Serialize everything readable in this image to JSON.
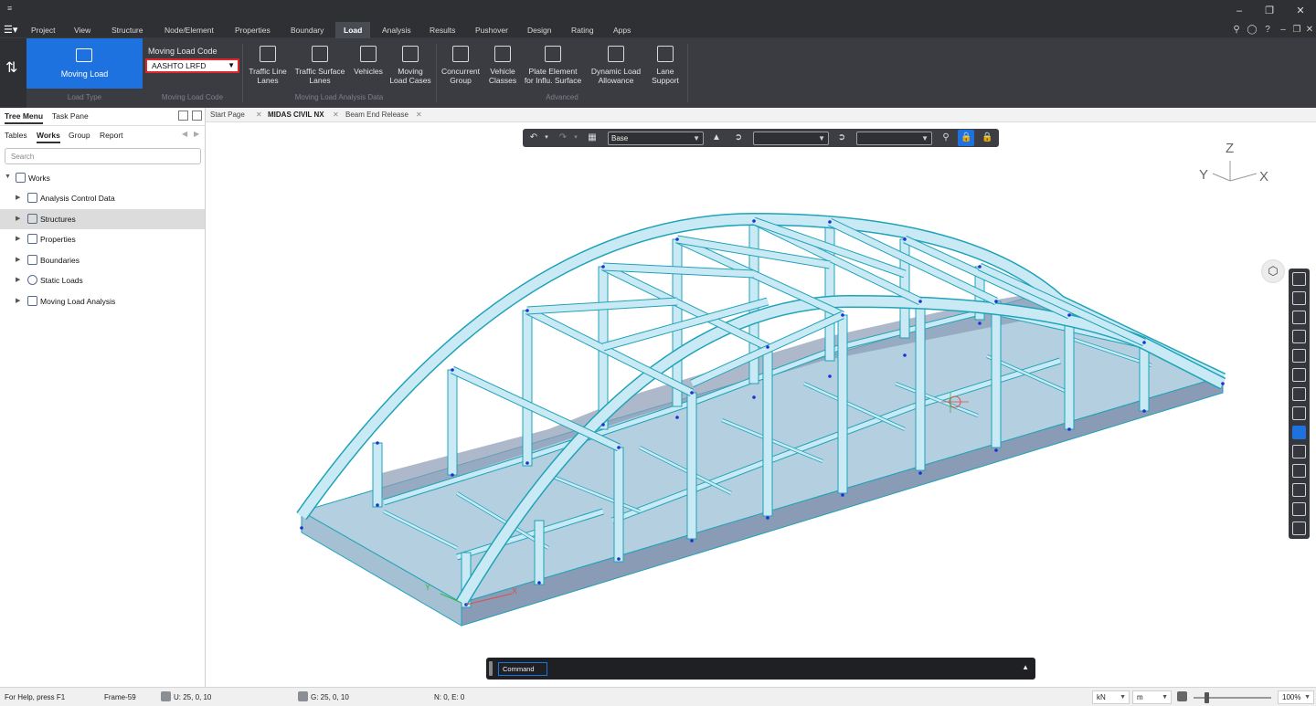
{
  "menu": {
    "tabs": [
      "Project",
      "View",
      "Structure",
      "Node/Element",
      "Properties",
      "Boundary",
      "Load",
      "Analysis",
      "Results",
      "Pushover",
      "Design",
      "Rating",
      "Apps"
    ],
    "active": "Load"
  },
  "ribbon": {
    "moving_load_label": "Moving Load",
    "load_type_group": "Load Type",
    "code_label": "Moving Load Code",
    "code_value": "AASHTO LRFD",
    "code_group": "Moving Load Code",
    "analysis_data_group": "Moving Load Analysis Data",
    "advanced_group": "Advanced",
    "buttons": {
      "traffic_line_1": "Traffic Line",
      "traffic_line_2": "Lanes",
      "traffic_surface_1": "Traffic Surface",
      "traffic_surface_2": "Lanes",
      "vehicles_1": "Vehicles",
      "moving_cases_1": "Moving",
      "moving_cases_2": "Load Cases",
      "concurrent_1": "Concurrent",
      "concurrent_2": "Group",
      "vehicle_classes_1": "Vehicle",
      "vehicle_classes_2": "Classes",
      "plate_element_1": "Plate Element",
      "plate_element_2": "for Influ. Surface",
      "dynamic_1": "Dynamic Load",
      "dynamic_2": "Allowance",
      "lane_support_1": "Lane",
      "lane_support_2": "Support"
    }
  },
  "panel": {
    "tab_tree": "Tree Menu",
    "tab_task": "Task Pane",
    "sub_tables": "Tables",
    "sub_works": "Works",
    "sub_group": "Group",
    "sub_report": "Report",
    "search_placeholder": "Search",
    "root": "Works",
    "items": [
      "Analysis Control Data",
      "Structures",
      "Properties",
      "Boundaries",
      "Static Loads",
      "Moving Load Analysis"
    ]
  },
  "doc_tabs": [
    "Start Page",
    "MIDAS CIVIL NX",
    "Beam End Release"
  ],
  "view_toolbar": {
    "base_select": "Base"
  },
  "axes": {
    "z": "Z",
    "y": "Y",
    "x": "X"
  },
  "model_axis": {
    "y": "Y",
    "x": "X"
  },
  "command": {
    "label": "Command"
  },
  "status": {
    "help": "For Help, press F1",
    "frame": "Frame-59",
    "u": "U: 25, 0, 10",
    "g": "G: 25, 0, 10",
    "ne": "N: 0, E: 0",
    "force_unit": "kN",
    "length_unit": "m",
    "zoom": "100%"
  },
  "colors": {
    "accent": "#1d72e0",
    "ribbon_bg": "#3a3c42",
    "highlight_border": "#e0262a",
    "member_fill": "#c9eaf5",
    "member_stroke": "#1fa3b8",
    "deck_side": "#8a9bb5",
    "node": "#1a32d8"
  }
}
